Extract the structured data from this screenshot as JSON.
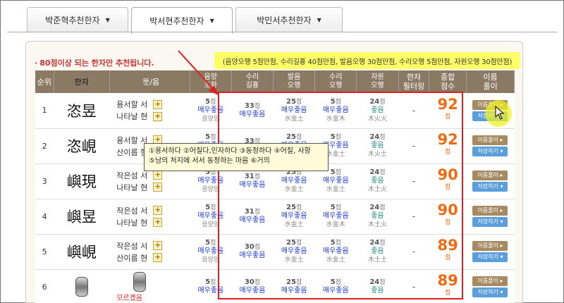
{
  "tabs": [
    {
      "label_name": "박준혁",
      "label_suffix": " 추천한자"
    },
    {
      "label_name": "박서현",
      "label_suffix": " 추천한자"
    },
    {
      "label_name": "박민서",
      "label_suffix": " 추천한자"
    }
  ],
  "active_tab": 1,
  "notice": "80점이상 되는 한자만 추천됩니다.",
  "criteria": "(음양오행 5점만점, 수리길흉 40점만점, 발음오행 30점만점, 수리오행 5점만점, 자원오행 30점만점)",
  "headers": {
    "no": "순위",
    "hanja": "한자",
    "meaning": "뜻/음",
    "eumyang": [
      "음양",
      "조화"
    ],
    "suri": [
      "수리",
      "길흉"
    ],
    "bareum": [
      "발음",
      "오행"
    ],
    "surio": [
      "수리",
      "오행"
    ],
    "jawon": [
      "자원",
      "오행"
    ],
    "filter": [
      "한자",
      "필터링"
    ],
    "total": [
      "종합",
      "점수"
    ],
    "name": [
      "이름",
      "풀이"
    ]
  },
  "buttons": {
    "name": "이름풀이 ▸",
    "save": "저장하기 ▾"
  },
  "rows": [
    {
      "no": "1",
      "hanja": "恣昱",
      "m1": "용서할 서",
      "m2": "나타날 현",
      "eumyang": {
        "pts": "5",
        "l1": "매우좋음",
        "l2": "음양양"
      },
      "suri": {
        "pts": "33",
        "l1": "매우좋음",
        "l2": ""
      },
      "bareum": {
        "pts": "25",
        "l1": "매우좋음",
        "l2": "水金土"
      },
      "surio": {
        "pts": "5",
        "l1": "매우좋음",
        "l2": "水金木"
      },
      "jawon": {
        "pts": "24",
        "l1": "좋음",
        "l2": "木火火"
      },
      "filter": "-",
      "total": "92"
    },
    {
      "no": "2",
      "hanja": "恣峴",
      "m1": "용서할 서",
      "m2": "산이름 현",
      "eumyang": {
        "pts": "5",
        "l1": "매우좋음",
        "l2": "음양양"
      },
      "suri": {
        "pts": "33",
        "l1": "매우좋음",
        "l2": ""
      },
      "bareum": {
        "pts": "25",
        "l1": "매우좋음",
        "l2": "水金土"
      },
      "surio": {
        "pts": "5",
        "l1": "매우좋음",
        "l2": "水金土"
      },
      "jawon": {
        "pts": "24",
        "l1": "좋음",
        "l2": "木火土"
      },
      "filter": "-",
      "total": "92"
    },
    {
      "no": "3",
      "hanja": "嶼現",
      "m1": "작은섬 서",
      "m2": "나타날 현",
      "eumyang": {
        "pts": "5",
        "l1": "매우좋음",
        "l2": "음양양"
      },
      "suri": {
        "pts": "31",
        "l1": "매우좋음",
        "l2": ""
      },
      "bareum": {
        "pts": "25",
        "l1": "매우좋음",
        "l2": "水金土"
      },
      "surio": {
        "pts": "5",
        "l1": "매우좋음",
        "l2": "水金土"
      },
      "jawon": {
        "pts": "24",
        "l1": "좋음",
        "l2": "木土火"
      },
      "filter": "-",
      "total": "90"
    },
    {
      "no": "4",
      "hanja": "嶼昱",
      "m1": "작은섬 서",
      "m2": "나타날 현",
      "eumyang": {
        "pts": "5",
        "l1": "매우좋음",
        "l2": "음양양"
      },
      "suri": {
        "pts": "31",
        "l1": "매우좋음",
        "l2": ""
      },
      "bareum": {
        "pts": "25",
        "l1": "매우좋음",
        "l2": "水金土"
      },
      "surio": {
        "pts": "5",
        "l1": "매우좋음",
        "l2": "水金木"
      },
      "jawon": {
        "pts": "24",
        "l1": "좋음",
        "l2": "木土火"
      },
      "filter": "-",
      "total": "90"
    },
    {
      "no": "5",
      "hanja": "嶼峴",
      "m1": "작은섬 서",
      "m2": "산이름 현",
      "eumyang": {
        "pts": "5",
        "l1": "매우좋음",
        "l2": "음양양"
      },
      "suri": {
        "pts": "30",
        "l1": "매우좋음",
        "l2": ""
      },
      "bareum": {
        "pts": "25",
        "l1": "매우좋음",
        "l2": "水金土"
      },
      "surio": {
        "pts": "5",
        "l1": "매우좋음",
        "l2": "水金土"
      },
      "jawon": {
        "pts": "24",
        "l1": "좋음",
        "l2": "木土土"
      },
      "filter": "-",
      "total": "89"
    },
    {
      "no": "6",
      "hanja": "",
      "m1": "",
      "m2": "모르겠음",
      "eumyang": {
        "pts": "5",
        "l1": "매우좋음",
        "l2": ""
      },
      "suri": {
        "pts": "30",
        "l1": "매우좋음",
        "l2": ""
      },
      "bareum": {
        "pts": "25",
        "l1": "매우좋음",
        "l2": ""
      },
      "surio": {
        "pts": "5",
        "l1": "매우좋음",
        "l2": ""
      },
      "jawon": {
        "pts": "24",
        "l1": "좋음",
        "l2": ""
      },
      "filter": "-",
      "total": "89"
    }
  ],
  "point_unit": "점",
  "tooltip": {
    "line1": "①용서하다 ②어질다,인자하다 ③동정하다 ④어질, 사항",
    "line2": "⑤남의 처지에 서서 동정하는 마음 ⑥거의"
  },
  "colors": {
    "header_bg": "#8a7a64",
    "accent_orange": "#ef6a10",
    "good_blue": "#1b38d8",
    "highlight_yellow": "#ffff66",
    "annotation_red": "#e02020"
  }
}
